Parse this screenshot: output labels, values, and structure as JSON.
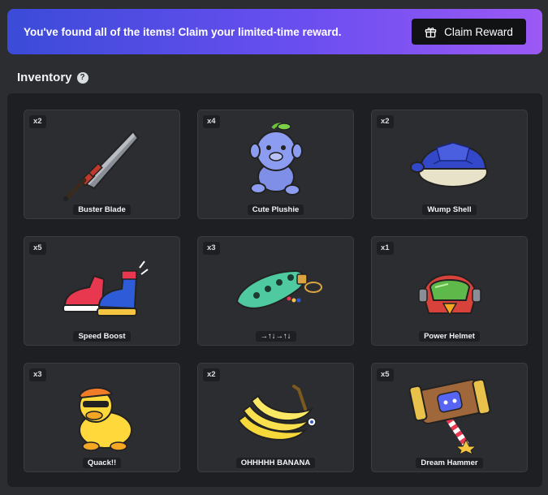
{
  "banner": {
    "message": "You've found all of the items! Claim your limited-time reward.",
    "button_label": "Claim Reward",
    "button_icon": "gift-icon"
  },
  "inventory": {
    "title": "Inventory",
    "help_icon": "question-circle-icon",
    "items": [
      {
        "count": "x2",
        "name": "Buster Blade",
        "icon": "buster-blade-icon"
      },
      {
        "count": "x4",
        "name": "Cute Plushie",
        "icon": "plushie-icon"
      },
      {
        "count": "x2",
        "name": "Wump Shell",
        "icon": "shell-icon"
      },
      {
        "count": "x5",
        "name": "Speed Boost",
        "icon": "sneakers-icon"
      },
      {
        "count": "x3",
        "name": "→↑↓→↑↓",
        "icon": "ocarina-icon"
      },
      {
        "count": "x1",
        "name": "Power Helmet",
        "icon": "helmet-icon"
      },
      {
        "count": "x3",
        "name": "Quack!!",
        "icon": "duck-icon"
      },
      {
        "count": "x2",
        "name": "OHHHHH BANANA",
        "icon": "banana-icon"
      },
      {
        "count": "x5",
        "name": "Dream Hammer",
        "icon": "hammer-icon"
      }
    ]
  }
}
